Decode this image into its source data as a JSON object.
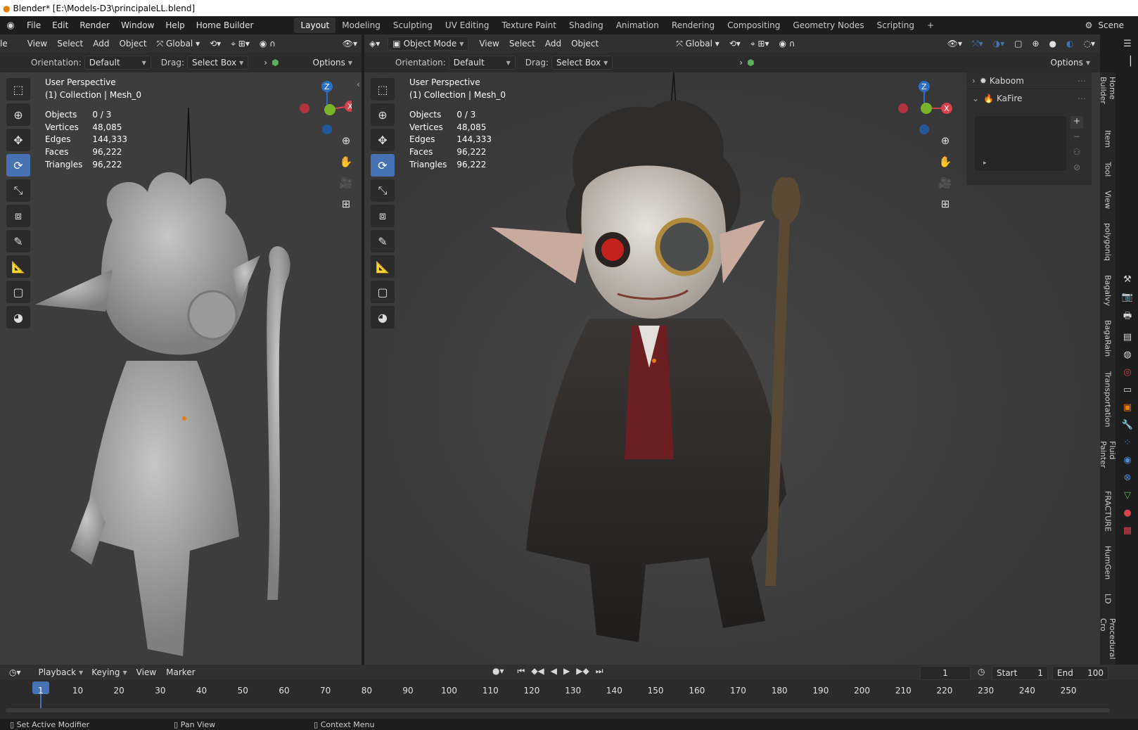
{
  "window": {
    "title": "Blender* [E:\\Models-D3\\principaleLL.blend]",
    "logo_icon": "blender-logo-icon"
  },
  "menu": {
    "items": [
      "File",
      "Edit",
      "Render",
      "Window",
      "Help",
      "Home Builder"
    ]
  },
  "workspaces": {
    "tabs": [
      "Layout",
      "Modeling",
      "Sculpting",
      "UV Editing",
      "Texture Paint",
      "Shading",
      "Animation",
      "Rendering",
      "Compositing",
      "Geometry Nodes",
      "Scripting"
    ],
    "active": "Layout",
    "add_icon": "plus-icon"
  },
  "scene": {
    "label": "Scene"
  },
  "left_view": {
    "header": {
      "mode_partial": "le",
      "menus": [
        "View",
        "Select",
        "Add",
        "Object"
      ],
      "transform": "Global"
    },
    "header2": {
      "orientation_label": "Orientation:",
      "orientation_value": "Default",
      "drag_label": "Drag:",
      "drag_value": "Select Box",
      "options": "Options"
    },
    "overlay": {
      "line1": "User Perspective",
      "line2": "(1) Collection | Mesh_0"
    },
    "stats": [
      {
        "k": "Objects",
        "v": "0 / 3"
      },
      {
        "k": "Vertices",
        "v": "48,085"
      },
      {
        "k": "Edges",
        "v": "144,333"
      },
      {
        "k": "Faces",
        "v": "96,222"
      },
      {
        "k": "Triangles",
        "v": "96,222"
      }
    ]
  },
  "right_view": {
    "header": {
      "mode": "Object Mode",
      "menus": [
        "View",
        "Select",
        "Add",
        "Object"
      ],
      "transform": "Global"
    },
    "header2": {
      "orientation_label": "Orientation:",
      "orientation_value": "Default",
      "drag_label": "Drag:",
      "drag_value": "Select Box",
      "options": "Options"
    },
    "overlay": {
      "line1": "User Perspective",
      "line2": "(1) Collection | Mesh_0"
    },
    "stats": [
      {
        "k": "Objects",
        "v": "0 / 3"
      },
      {
        "k": "Vertices",
        "v": "48,085"
      },
      {
        "k": "Edges",
        "v": "144,333"
      },
      {
        "k": "Faces",
        "v": "96,222"
      },
      {
        "k": "Triangles",
        "v": "96,222"
      }
    ]
  },
  "n_panel": {
    "items": [
      {
        "label": "Kaboom",
        "expanded": false
      },
      {
        "label": "KaFire",
        "expanded": true
      }
    ]
  },
  "side_tabs": [
    "Home Builder",
    "Item",
    "Tool",
    "View",
    "polygoniq",
    "Bagalvy",
    "BagaRain",
    "Transportation",
    "Fluid Painter",
    "FRACTURE",
    "HumGen",
    "LD",
    "Procedural Cro"
  ],
  "timeline": {
    "menus": [
      "Playback",
      "Keying",
      "View",
      "Marker"
    ],
    "current_frame": "1",
    "start_label": "Start",
    "start": "1",
    "end_label": "End",
    "end": "100",
    "ticks": [
      "1",
      "10",
      "20",
      "30",
      "40",
      "50",
      "60",
      "70",
      "80",
      "90",
      "100",
      "110",
      "120",
      "130",
      "140",
      "150",
      "160",
      "170",
      "180",
      "190",
      "200",
      "210",
      "220",
      "230",
      "240",
      "250"
    ]
  },
  "status": {
    "items": [
      "Set Active Modifier",
      "Pan View",
      "Context Menu"
    ]
  },
  "colors": {
    "accent": "#4772b3",
    "x_axis": "#d9414e",
    "y_axis": "#7ab32a",
    "z_axis": "#2b6fc6",
    "viewport": "#3d3d3d"
  }
}
